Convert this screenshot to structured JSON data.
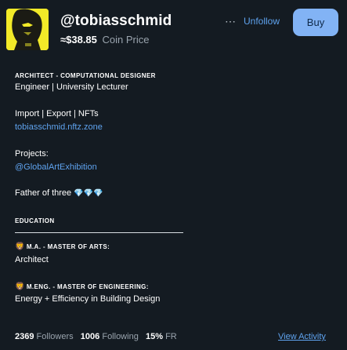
{
  "profile": {
    "username": "@tobiasschmid",
    "coin_price": "≈$38.85",
    "coin_price_label": "Coin Price",
    "more_icon": "⋯",
    "unfollow_label": "Unfollow",
    "buy_label": "Buy"
  },
  "bio": {
    "title_line": "ARCHITECT - COMPUTATIONAL DESIGNER",
    "role_line": "Engineer | University Lecturer",
    "services_line": "Import | Export | NFTs",
    "website": "tobiasschmid.nftz.zone",
    "projects_label": "Projects:",
    "projects_link": "@GlobalArtExhibition",
    "father_text": "Father of three",
    "father_emoji": "💎💎💎",
    "education_heading": "EDUCATION",
    "edu1_title": "M.A. - MASTER OF ARTS:",
    "edu1_detail": "Architect",
    "edu2_title": "M.ENG. - MASTER OF ENGINEERING:",
    "edu2_detail": "Energy + Efficiency in Building Design"
  },
  "stats": {
    "followers_count": "2369",
    "followers_label": "Followers",
    "following_count": "1006",
    "following_label": "Following",
    "fr_value": "15%",
    "fr_label": "FR",
    "view_activity": "View Activity"
  },
  "icons": {
    "avatar": "avatar-portrait",
    "lion": "lion-face-icon"
  },
  "colors": {
    "background": "#141b22",
    "link": "#5fa3ef",
    "buy_button": "#82b3f5",
    "avatar_bg": "#f2ea28"
  }
}
